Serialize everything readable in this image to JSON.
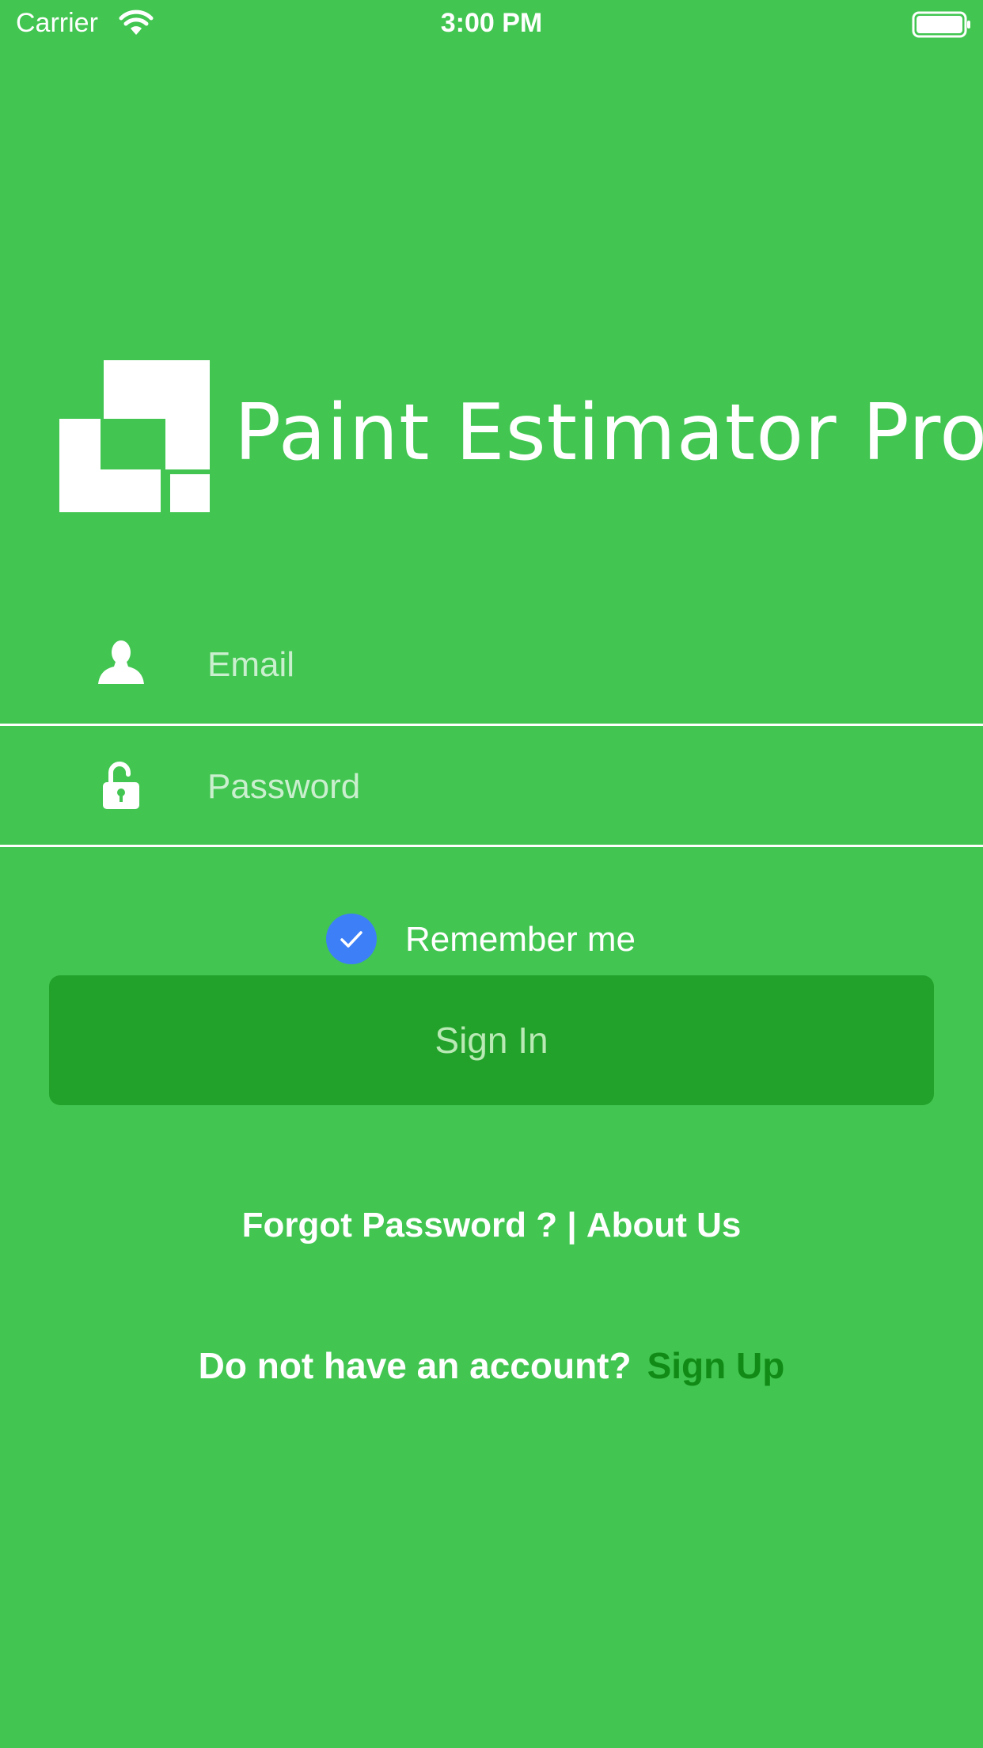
{
  "status_bar": {
    "carrier": "Carrier",
    "time": "3:00 PM"
  },
  "app": {
    "title": "Paint Estimator Pro"
  },
  "form": {
    "email_placeholder": "Email",
    "password_placeholder": "Password",
    "remember_label": "Remember me",
    "remember_checked": true,
    "signin_label": "Sign In"
  },
  "links": {
    "forgot_password": "Forgot Password ?",
    "separator": "|",
    "about_us": "About Us",
    "no_account": "Do not have an account?",
    "sign_up": "Sign Up"
  },
  "icons": {
    "wifi": "wifi-icon",
    "battery": "battery-icon",
    "logo": "logo-icon",
    "email": "user-icon",
    "password": "unlock-icon",
    "remember": "checkmark-icon"
  },
  "colors": {
    "background": "#42c651",
    "button": "#22a22b",
    "button_text": "#b9e9b4",
    "checkbox": "#3d7ff7",
    "signup_link": "#118a16"
  }
}
